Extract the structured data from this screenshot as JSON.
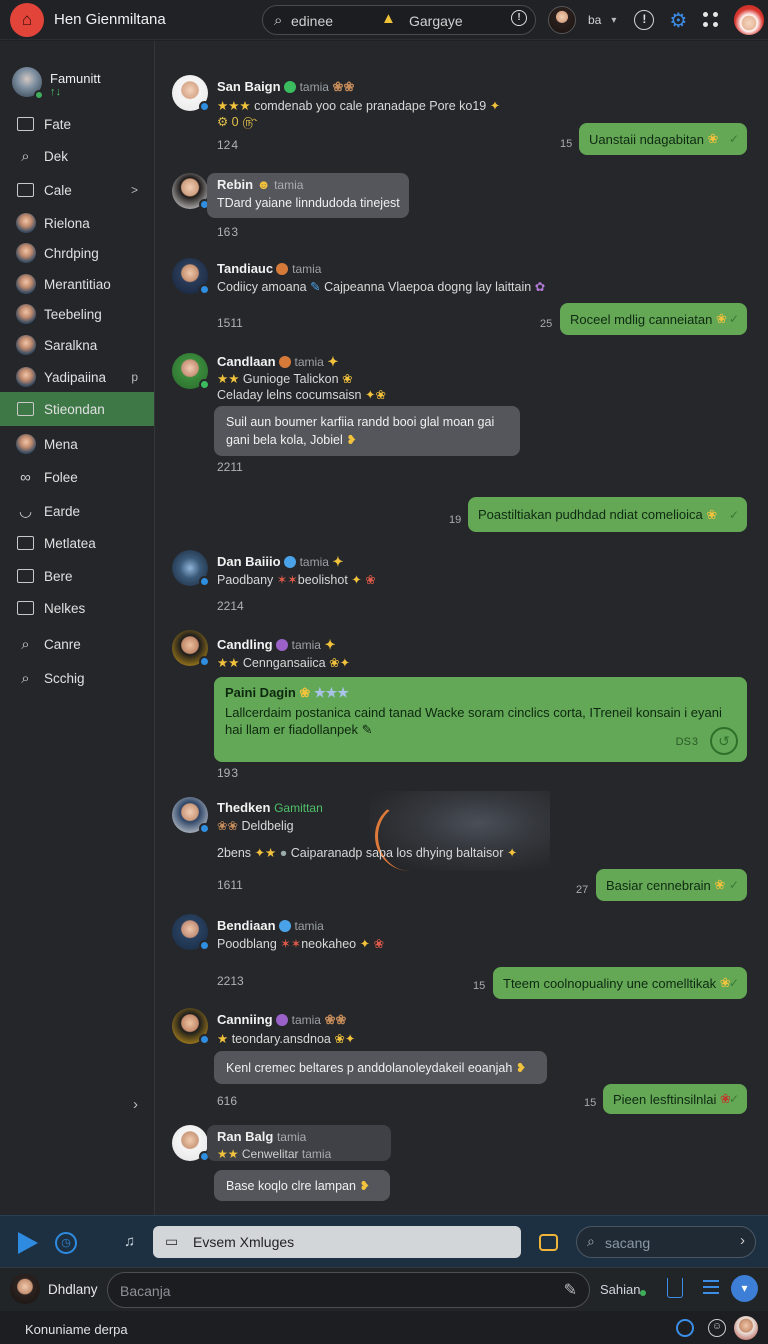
{
  "header": {
    "app_title": "Hen Gienmiltana",
    "search_text": "edinee",
    "search_category": "Gargaye",
    "user_label": "ba"
  },
  "sidebar": {
    "profile_name": "Famunitt",
    "profile_sub": "↑↓",
    "items": [
      {
        "label": "Fate",
        "icon": "mail-icon"
      },
      {
        "label": "Dek",
        "icon": "search-icon"
      },
      {
        "label": "Cale",
        "icon": "mail-icon",
        "tail": ">"
      },
      {
        "label": "Rielona",
        "icon": "avatar"
      },
      {
        "label": "Chrdping",
        "icon": "avatar"
      },
      {
        "label": "Merantitiao",
        "icon": "avatar"
      },
      {
        "label": "Teebeling",
        "icon": "avatar"
      },
      {
        "label": "Saralkna",
        "icon": "avatar"
      },
      {
        "label": "Yadipaiina",
        "icon": "avatar",
        "tail": "p"
      },
      {
        "label": "Stieondan",
        "icon": "mail-icon",
        "active": true
      },
      {
        "label": "Mena",
        "icon": "avatar"
      },
      {
        "label": "Folee",
        "icon": "link-icon"
      },
      {
        "label": "Earde",
        "icon": "cup-icon"
      },
      {
        "label": "Metlatea",
        "icon": "mail-icon"
      },
      {
        "label": "Bere",
        "icon": "mail-icon"
      },
      {
        "label": "Nelkes",
        "icon": "mail-icon"
      },
      {
        "label": "Canre",
        "icon": "search-icon"
      },
      {
        "label": "Scchig",
        "icon": "search-icon"
      }
    ]
  },
  "messages": {
    "m1": {
      "name": "San Baign",
      "tag": "tamia",
      "line1": "comdenab yoo cale pranadape Pore ko19",
      "line2": "⚙ 0 ௹",
      "time": "12 4"
    },
    "o1": {
      "text": "Uanstaii ndagabitan",
      "time": "15"
    },
    "m2": {
      "name": "Rebin",
      "tag": "tamia",
      "bubble": "TDard yaiane linndudoda tinejest",
      "time": "16 3"
    },
    "m3": {
      "name": "Tandiauc",
      "tag": "tamia",
      "lead": "Codiicy amoana",
      "line1": "Cajpeanna Vlaepoa dogng lay laittain",
      "time": "1511"
    },
    "o2": {
      "text": "Roceel mdlig canneiatan",
      "time": "25"
    },
    "m4": {
      "name": "Candlaan",
      "tag": "tamia",
      "line1": "Gunioge Talickon",
      "line2": "Celaday lelns cocumsaisn",
      "bubble1": "Suil aun boumer karfiia  randd booi glal moan gai",
      "bubble2": "gani bela kola, Jobiel",
      "time": "2211"
    },
    "o3": {
      "text": "Poastiltiakan pudhdad ndiat comelioica",
      "time": "19"
    },
    "m5": {
      "name": "Dan Baiiio",
      "tag": "tamia",
      "lead": "Paodbany",
      "pink": "beolishot",
      "time": "2214"
    },
    "m6": {
      "name": "Candling",
      "tag": "tamia",
      "line1": "Cenngansaiica",
      "time": "19 3"
    },
    "big": {
      "title": "Paini Dagin",
      "body": "Lallcerdaim postanica caind tanad Wacke soram cinclics corta, ITreneil konsain i eyani hai llam er fiadollanpek",
      "time": "DS 3"
    },
    "m7": {
      "name": "Thedken",
      "tag": "Gamittan",
      "sub": "Deldbelig",
      "lead": "2bens",
      "line1": "Caiparanadp sapa los dhying baltaisor",
      "time": "1611"
    },
    "o4": {
      "text": "Basiar cennebrain",
      "time": "27"
    },
    "m8": {
      "name": "Bendiaan",
      "tag": "tamia",
      "lead": "Poodblang",
      "pink": "neokaheo",
      "time": "2213"
    },
    "o5": {
      "text": "Tteem coolnopualiny une comelltikak",
      "time": "15"
    },
    "m9": {
      "name": "Canniing",
      "tag": "tamia",
      "line1": "teondary.ansdnoa",
      "bubble": "Kenl cremec beltares p anddolanoleydakeil eoanjah",
      "time": "616"
    },
    "o6": {
      "text": "Pieen lesftinsilnlai",
      "time": "15"
    },
    "m10": {
      "name": "Ran Balg",
      "tag": "tamia",
      "line1": "Cenwelitar",
      "tag2": "tamia",
      "bubble": "Base koqlo clre lampan"
    }
  },
  "composer": {
    "tab_label": "Evsem Xmluges",
    "search_placeholder": "sacang",
    "user_name": "Dhdlany",
    "input_placeholder": "Bacanja",
    "status_name": "Sahian",
    "footer_text": "Konuniame derpa"
  },
  "colors": {
    "accent": "#3c8de6",
    "outgoing": "#64a856",
    "active_nav": "#3e7847",
    "brand": "#e2443a"
  }
}
